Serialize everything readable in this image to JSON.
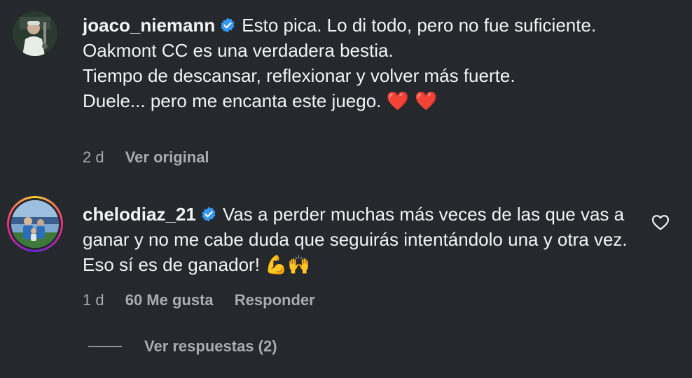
{
  "comments": [
    {
      "username": "joaco_niemann",
      "text": "Esto pica. Lo di todo, pero no fue suficiente.\nOakmont CC es una verdadera bestia.\nTiempo de descansar, reflexionar y volver más fuerte.\nDuele... pero me encanta este juego.",
      "emoji": "❤️ ❤️",
      "time": "2 d",
      "action_label": "Ver original"
    },
    {
      "username": "chelodiaz_21",
      "text": "Vas a perder muchas más veces de las que vas a ganar y no me cabe duda que seguirás intentándolo una y otra vez. Eso sí es de ganador!",
      "emoji": "💪🙌",
      "time": "1 d",
      "likes_label": "60 Me gusta",
      "reply_label": "Responder"
    }
  ],
  "view_replies_label": "Ver respuestas (2)",
  "colors": {
    "background": "#25282c",
    "verified": "#3797f0",
    "heart": "#e0245e",
    "muted": "#a8abb1"
  },
  "icons": [
    "verified-badge-icon",
    "heart-outline-icon",
    "flexed-biceps-emoji",
    "raising-hands-emoji"
  ]
}
